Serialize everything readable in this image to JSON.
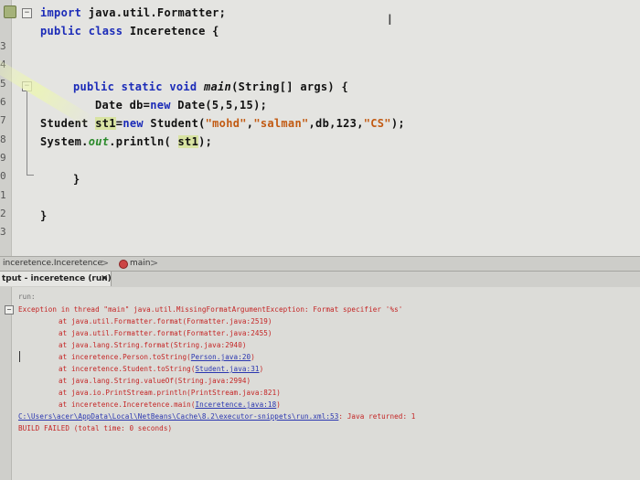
{
  "editor": {
    "line_numbers": [
      "3",
      "4",
      "5",
      "6",
      "7",
      "8",
      "9",
      "0",
      "1",
      "2",
      "3"
    ],
    "code": {
      "l1": {
        "kw": "import",
        "rest": " java.util.Formatter;"
      },
      "l2": {
        "kw1": "public",
        "kw2": "class",
        "name": " Inceretence {"
      },
      "l5": {
        "kw": "public static void",
        "m": " main",
        "rest": "(String[] args) {"
      },
      "l6": {
        "a": "Date db=",
        "kw": "new",
        "b": " Date(5,5,15);"
      },
      "l7": {
        "a": "Student ",
        "var": "st1",
        "b": "=",
        "kw": "new",
        "c": " Student(",
        "s1": "\"mohd\"",
        "d": ",",
        "s2": "\"salman\"",
        "e": ",db,123,",
        "s3": "\"CS\"",
        "f": ");"
      },
      "l8": {
        "a": "System.",
        "fld": "out",
        "b": ".println( ",
        "var": "st1",
        "c": ");"
      },
      "l10": "}",
      "l12": "}"
    }
  },
  "breadcrumb": {
    "item1": "inceretence.Inceretence",
    "sep": ">",
    "item2": "main"
  },
  "output_panel": {
    "tab_label": "tput - inceretence (run)",
    "close_glyph": "×",
    "lines": {
      "run": "run:",
      "exc": "Exception in thread \"main\" java.util.MissingFormatArgumentException: Format specifier '%s'",
      "t1": "at java.util.Formatter.format(Formatter.java:2519)",
      "t2": "at java.util.Formatter.format(Formatter.java:2455)",
      "t3": "at java.lang.String.format(String.java:2940)",
      "t4a": "at inceretence.Person.toString(",
      "t4b": "Person.java:20",
      "t4c": ")",
      "t5a": "at inceretence.Student.toString(",
      "t5b": "Student.java:31",
      "t5c": ")",
      "t6": "at java.lang.String.valueOf(String.java:2994)",
      "t7": "at java.io.PrintStream.println(PrintStream.java:821)",
      "t8a": "at inceretence.Inceretence.main(",
      "t8b": "Inceretence.java:18",
      "t8c": ")",
      "path": "C:\\Users\\acer\\AppData\\Local\\NetBeans\\Cache\\8.2\\executor-snippets\\run.xml:53",
      "ret": ": Java returned: 1",
      "build": "BUILD FAILED (total time: 0 seconds)"
    }
  }
}
